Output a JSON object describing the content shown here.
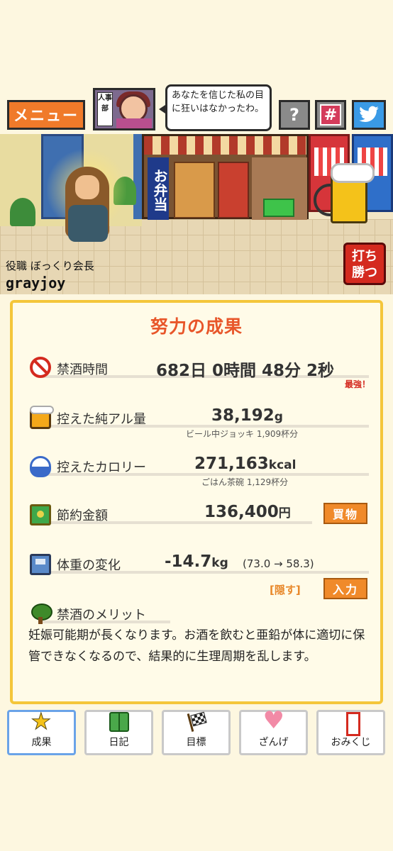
{
  "header": {
    "menu_label": "メニュー",
    "dept_label": "人事部",
    "speech": "あなたを信じた私の目に狂いはなかったわ。",
    "help_label": "?",
    "hash_label": "#",
    "twitter_icon": "twitter-bird-icon"
  },
  "scene": {
    "role": "役職 ぼっくり会長",
    "username": "grayjoy",
    "fight_label_1": "打ち",
    "fight_label_2": "勝つ",
    "shop_sign": "お弁当"
  },
  "results": {
    "title": "努力の成果",
    "abstinence": {
      "label": "禁酒時間",
      "value": "682日 0時間 48分 2秒",
      "badge": "最強！"
    },
    "alcohol": {
      "label": "控えた純アル量",
      "value": "38,192",
      "unit": "g",
      "sub": "ビール中ジョッキ 1,909杯分"
    },
    "calorie": {
      "label": "控えたカロリー",
      "value": "271,163",
      "unit": "kcal",
      "sub": "ごはん茶碗 1,129杯分"
    },
    "savings": {
      "label": "節約金額",
      "value": "136,400",
      "unit": "円",
      "button": "買物"
    },
    "weight": {
      "label": "体重の変化",
      "value": "-14.7",
      "unit": "kg",
      "detail": "(73.0 → 58.3)",
      "hide_label": "[隠す]",
      "input_button": "入力"
    },
    "merit": {
      "label": "禁酒のメリット",
      "text": "妊娠可能期が長くなります。お酒を飲むと亜鉛が体に適切に保管できなくなるので、結果的に生理周期を乱します。"
    }
  },
  "tabs": [
    {
      "label": "成果",
      "icon": "star-icon",
      "active": true
    },
    {
      "label": "日記",
      "icon": "book-icon",
      "active": false
    },
    {
      "label": "目標",
      "icon": "flag-icon",
      "active": false
    },
    {
      "label": "ざんげ",
      "icon": "heart-icon",
      "active": false
    },
    {
      "label": "おみくじ",
      "icon": "omikuji-icon",
      "active": false
    }
  ],
  "colors": {
    "accent": "#f07a2a",
    "title": "#e8562a",
    "panel_border": "#f4c63a",
    "weight_value": "#3a7ad4",
    "badge": "#d42a1f"
  }
}
